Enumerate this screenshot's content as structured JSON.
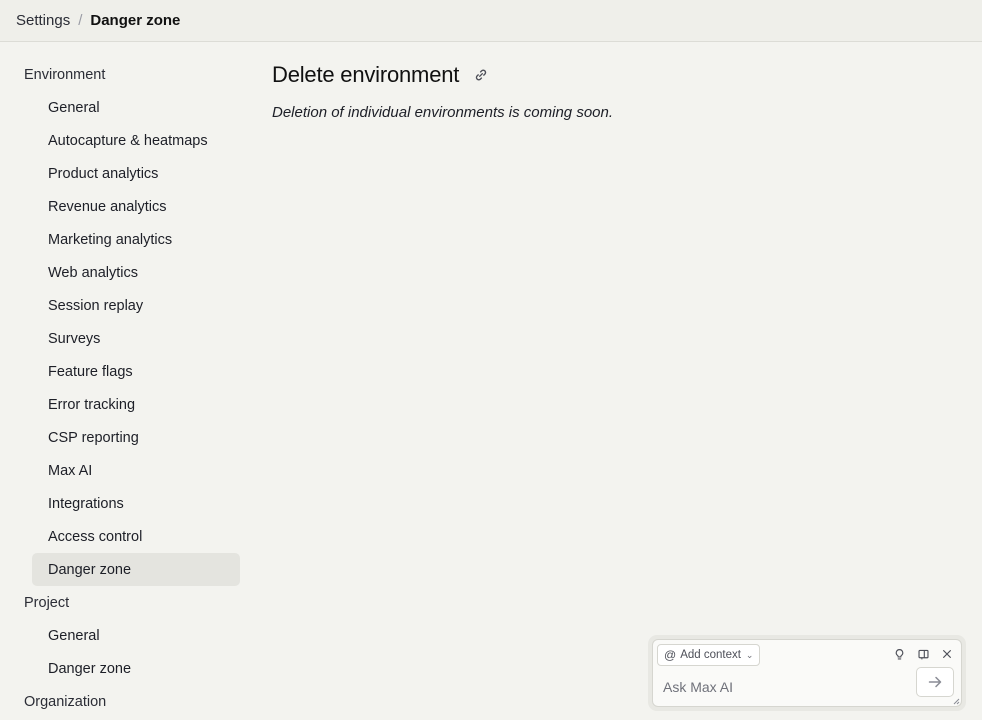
{
  "breadcrumb": {
    "root": "Settings",
    "separator": "/",
    "current": "Danger zone"
  },
  "sidebar": {
    "sections": [
      {
        "label": "Environment",
        "items": [
          {
            "label": "General"
          },
          {
            "label": "Autocapture & heatmaps"
          },
          {
            "label": "Product analytics"
          },
          {
            "label": "Revenue analytics"
          },
          {
            "label": "Marketing analytics"
          },
          {
            "label": "Web analytics"
          },
          {
            "label": "Session replay"
          },
          {
            "label": "Surveys"
          },
          {
            "label": "Feature flags"
          },
          {
            "label": "Error tracking"
          },
          {
            "label": "CSP reporting"
          },
          {
            "label": "Max AI"
          },
          {
            "label": "Integrations"
          },
          {
            "label": "Access control"
          },
          {
            "label": "Danger zone",
            "active": true
          }
        ]
      },
      {
        "label": "Project",
        "items": [
          {
            "label": "General"
          },
          {
            "label": "Danger zone"
          }
        ]
      },
      {
        "label": "Organization",
        "items": []
      }
    ]
  },
  "main": {
    "title": "Delete environment",
    "notice": "Deletion of individual environments is coming soon."
  },
  "max": {
    "add_context_label": "Add context",
    "input_placeholder": "Ask Max AI",
    "icons": [
      "lightbulb-icon",
      "open-side-panel-icon",
      "close-icon"
    ]
  },
  "colors": {
    "background": "#f3f3ef",
    "active_item": "#e4e4df",
    "border": "#dcdcd6"
  }
}
